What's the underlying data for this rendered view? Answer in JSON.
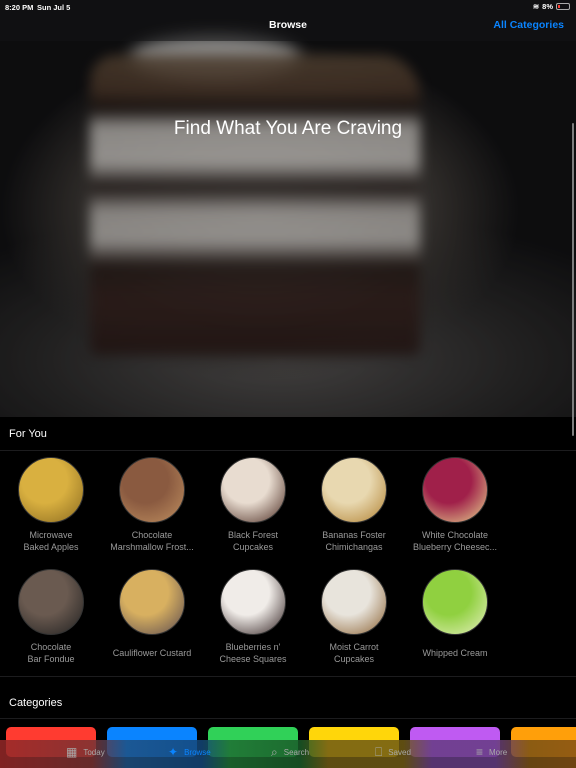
{
  "status_bar": {
    "time": "8:20 PM",
    "date": "Sun Jul 5",
    "battery": "8%",
    "wifi_icon": "wifi-icon",
    "battery_icon": "battery-low-icon"
  },
  "nav": {
    "title": "Browse",
    "action": "All Categories",
    "accent": "#0a84ff"
  },
  "hero": {
    "title": "Find What You Are Craving"
  },
  "for_you": {
    "heading": "For You",
    "items": [
      {
        "label": "Microwave Baked Apples",
        "l1": "Microwave",
        "l2": "Baked Apples",
        "colors": [
          "#d9b040",
          "#8a6a20"
        ]
      },
      {
        "label": "Chocolate Marshmallow Frost...",
        "l1": "Chocolate",
        "l2": "Marshmallow Frost...",
        "colors": [
          "#8a5a40",
          "#c09060"
        ]
      },
      {
        "label": "Black Forest Cupcakes",
        "l1": "Black Forest",
        "l2": "Cupcakes",
        "colors": [
          "#e8dcd0",
          "#4a2a20"
        ]
      },
      {
        "label": "Bananas Foster Chimichangas",
        "l1": "Bananas Foster",
        "l2": "Chimichangas",
        "colors": [
          "#e8d8b0",
          "#b08030"
        ]
      },
      {
        "label": "White Chocolate Blueberry Cheesec...",
        "l1": "White Chocolate",
        "l2": "Blueberry Cheesec...",
        "colors": [
          "#a0204a",
          "#e8d890"
        ]
      },
      {
        "label": "Chocolate Bar Fondue",
        "l1": "Chocolate",
        "l2": "Bar Fondue",
        "colors": [
          "#6a5a50",
          "#202020"
        ]
      },
      {
        "label": "Cauliflower Custard",
        "l1": "Cauliflower Custard",
        "l2": "",
        "colors": [
          "#d8b060",
          "#5a4a50"
        ]
      },
      {
        "label": "Blueberries n' Cheese Squares",
        "l1": "Blueberries n'",
        "l2": "Cheese Squares",
        "colors": [
          "#f0ece8",
          "#302020"
        ]
      },
      {
        "label": "Moist Carrot Cupcakes",
        "l1": "Moist Carrot",
        "l2": "Cupcakes",
        "colors": [
          "#e8e4dc",
          "#8a6030"
        ]
      },
      {
        "label": "Whipped Cream",
        "l1": "Whipped Cream",
        "l2": "",
        "colors": [
          "#90d040",
          "#e8f0c0"
        ]
      }
    ]
  },
  "categories": {
    "heading": "Categories",
    "tiles": [
      {
        "name": "category-red",
        "color": "#ff3b30"
      },
      {
        "name": "category-blue",
        "color": "#0a84ff"
      },
      {
        "name": "category-green",
        "color": "#30d158"
      },
      {
        "name": "category-yellow",
        "color": "#ffd60a"
      },
      {
        "name": "category-purple",
        "color": "#bf5af2"
      },
      {
        "name": "category-orange",
        "color": "#ff9f0a"
      }
    ]
  },
  "tabbar": {
    "tabs": [
      {
        "label": "Today",
        "icon": "calendar-icon",
        "glyph": "▦",
        "active": false
      },
      {
        "label": "Browse",
        "icon": "sparkles-icon",
        "glyph": "✦",
        "active": true
      },
      {
        "label": "Search",
        "icon": "search-icon",
        "glyph": "⌕",
        "active": false
      },
      {
        "label": "Saved",
        "icon": "bookmark-icon",
        "glyph": "⎕",
        "active": false
      },
      {
        "label": "More",
        "icon": "menu-icon",
        "glyph": "≡",
        "active": false
      }
    ]
  }
}
